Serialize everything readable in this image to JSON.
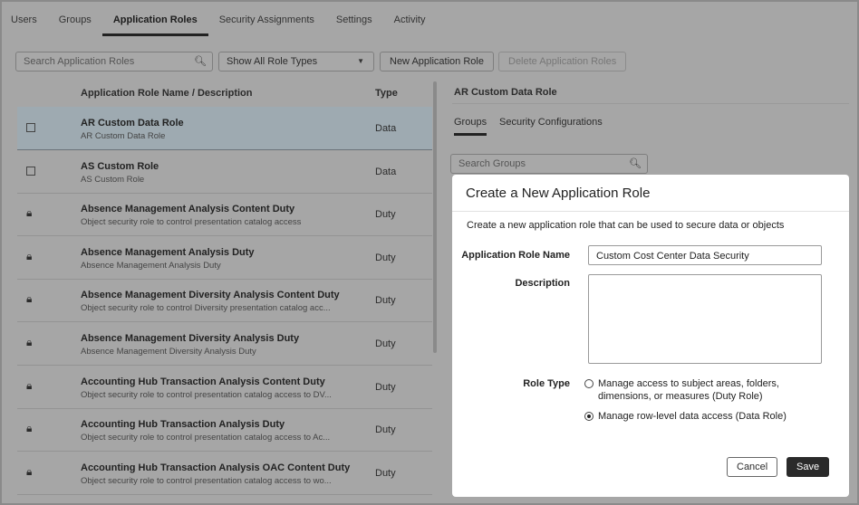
{
  "tabs": [
    "Users",
    "Groups",
    "Application Roles",
    "Security Assignments",
    "Settings",
    "Activity"
  ],
  "active_tab": "Application Roles",
  "toolbar": {
    "search_placeholder": "Search Application Roles",
    "filter_value": "Show All Role Types",
    "new_label": "New Application Role",
    "delete_label": "Delete Application Roles"
  },
  "table": {
    "col_name": "Application Role Name / Description",
    "col_type": "Type",
    "rows": [
      {
        "name": "AR Custom Data Role",
        "desc": "AR Custom Data Role",
        "type": "Data",
        "icon": "checkbox"
      },
      {
        "name": "AS Custom Role",
        "desc": "AS Custom Role",
        "type": "Data",
        "icon": "checkbox"
      },
      {
        "name": "Absence Management Analysis Content Duty",
        "desc": "Object security role to control presentation catalog access",
        "type": "Duty",
        "icon": "lock"
      },
      {
        "name": "Absence Management Analysis Duty",
        "desc": "Absence Management Analysis Duty",
        "type": "Duty",
        "icon": "lock"
      },
      {
        "name": "Absence Management Diversity Analysis Content Duty",
        "desc": "Object security role to control Diversity presentation catalog acc...",
        "type": "Duty",
        "icon": "lock"
      },
      {
        "name": "Absence Management Diversity Analysis Duty",
        "desc": "Absence Management Diversity Analysis Duty",
        "type": "Duty",
        "icon": "lock"
      },
      {
        "name": "Accounting Hub Transaction Analysis Content Duty",
        "desc": "Object security role to control presentation catalog access to DV...",
        "type": "Duty",
        "icon": "lock"
      },
      {
        "name": "Accounting Hub Transaction Analysis Duty",
        "desc": "Object security role to control presentation catalog access to Ac...",
        "type": "Duty",
        "icon": "lock"
      },
      {
        "name": "Accounting Hub Transaction Analysis OAC Content Duty",
        "desc": "Object security role to control presentation catalog access to wo...",
        "type": "Duty",
        "icon": "lock"
      }
    ]
  },
  "detail": {
    "title": "AR Custom Data Role",
    "tabs": [
      "Groups",
      "Security Configurations"
    ],
    "search_placeholder": "Search Groups"
  },
  "modal": {
    "title": "Create a New Application Role",
    "intro": "Create a new application role that can be used to secure data or objects",
    "name_label": "Application Role Name",
    "name_value": "Custom Cost Center Data Security",
    "desc_label": "Description",
    "desc_value": "",
    "role_type_label": "Role Type",
    "options": [
      {
        "label": "Manage access to subject areas, folders,",
        "label2": "dimensions, or measures (Duty Role)",
        "selected": false
      },
      {
        "label": "Manage row-level data access (Data Role)",
        "selected": true
      }
    ],
    "cancel": "Cancel",
    "save": "Save"
  }
}
